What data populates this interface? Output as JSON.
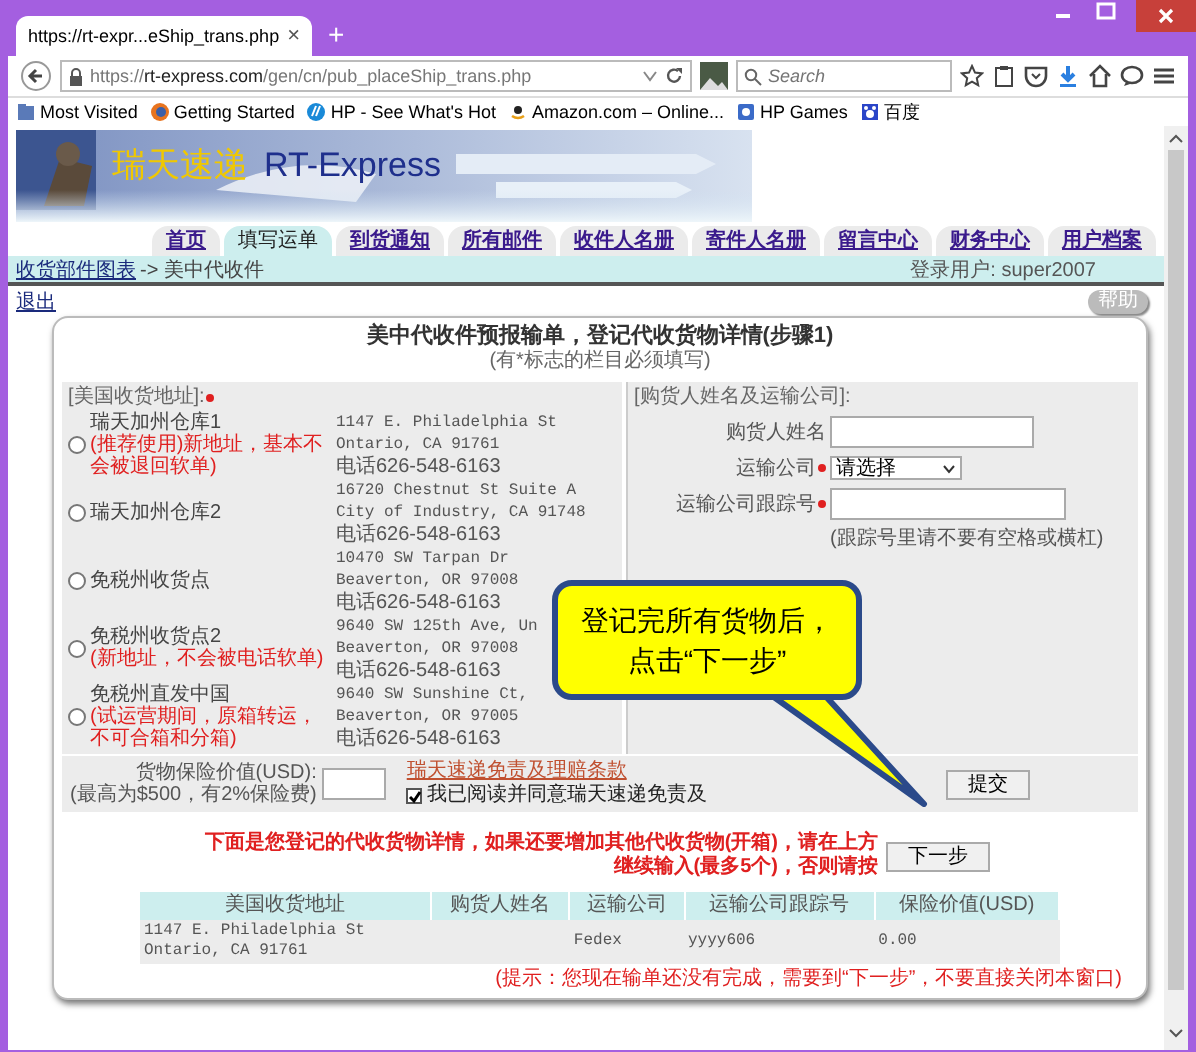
{
  "browser": {
    "tab_title": "https://rt-expr...eShip_trans.php",
    "tab_close": "×",
    "new_tab": "+",
    "url": "https://**rt-express.com**/gen/cn/pub_placeShip_trans.php",
    "search": {
      "placeholder": "Search"
    },
    "bookmarks": [
      "Most Visited",
      "Getting Started",
      "HP - See What's Hot",
      "Amazon.com – Online...",
      "HP Games",
      "百度"
    ]
  },
  "site": {
    "logo_cn": "瑞天速递",
    "logo_en": "RT-Express"
  },
  "nav_tabs": [
    {
      "label": "首页",
      "selected": false
    },
    {
      "label": "填写运单",
      "selected": true
    },
    {
      "label": "到货通知",
      "selected": false
    },
    {
      "label": "所有邮件",
      "selected": false
    },
    {
      "label": "收件人名册",
      "selected": false
    },
    {
      "label": "寄件人名册",
      "selected": false
    },
    {
      "label": "留言中心",
      "selected": false
    },
    {
      "label": "财务中心",
      "selected": false
    },
    {
      "label": "用户档案",
      "selected": false
    }
  ],
  "breadcrumb": {
    "link": "收货部件图表",
    "current": "-> 美中代收件",
    "user": "登录用户: super2007"
  },
  "logout": "退出",
  "help": "帮助",
  "form": {
    "title": "美中代收件预报输单，登记代收货物详情(步骤1)",
    "note": "(有*标志的栏目必须填写)",
    "address_panel": {
      "heading": "[美国收货地址]:",
      "required": true,
      "addresses": [
        {
          "name": "瑞天加州仓库1",
          "note": "(推荐使用)新地址，基本不会被退回软单)",
          "lines": [
            "1147 E. Philadelphia St",
            "Ontario, CA 91761"
          ],
          "phone": "电话626-548-6163",
          "selected": false
        },
        {
          "name": "瑞天加州仓库2",
          "lines": [
            "16720 Chestnut St Suite A",
            "City of Industry, CA 91748"
          ],
          "phone": "电话626-548-6163",
          "selected": false
        },
        {
          "name": "免税州收货点",
          "lines": [
            "10470 SW Tarpan Dr",
            "Beaverton, OR 97008"
          ],
          "phone": "电话626-548-6163",
          "selected": false
        },
        {
          "name": "免税州收货点2",
          "note": "(新地址，不会被电话软单)",
          "lines": [
            "9640 SW 125th Ave, Un",
            "Beaverton, OR 97008"
          ],
          "phone": "电话626-548-6163",
          "selected": false
        },
        {
          "name": "免税州直发中国",
          "note": "(试运营期间，原箱转运，不可合箱和分箱)",
          "lines": [
            "9640 SW Sunshine Ct,",
            "Beaverton, OR 97005"
          ],
          "phone": "电话626-548-6163",
          "selected": false
        }
      ]
    },
    "buyer_panel": {
      "heading": "[购货人姓名及运输公司]:",
      "fields": [
        {
          "kind": "text",
          "label": "购货人姓名",
          "required": false
        },
        {
          "kind": "select",
          "label": "运输公司",
          "required": true,
          "value": "请选择"
        },
        {
          "kind": "text",
          "label": "运输公司跟踪号",
          "required": true,
          "hint": "(跟踪号里请不要有空格或横杠)"
        }
      ]
    },
    "insurance": {
      "label": "货物保险价值(USD):",
      "sublabel": "(最高为$500，有2%保险费)",
      "terms_link": "瑞天速递免责及理赔条款",
      "agree": {
        "label": "我已阅读并同意瑞天速递免责及",
        "checked": true
      },
      "submit": "提交"
    },
    "instruction": "下面是您登记的代收货物详情，如果还要增加其他代收货物(开箱)，请在上方继续输入(最多5个)，否则请按",
    "next": "下一步",
    "table": {
      "columns": [
        "美国收货地址",
        "购货人姓名",
        "运输公司",
        "运输公司跟踪号",
        "保险价值(USD)"
      ],
      "rows": [
        [
          "1147 E. Philadelphia St\nOntario, CA 91761",
          "",
          "Fedex",
          "yyyy606",
          "0.00"
        ]
      ]
    },
    "tip": "(提示：您现在输单还没有完成，需要到“下一步”，不要直接关闭本窗口)"
  },
  "callout": "登记完所有货物后，点击“下一步”"
}
